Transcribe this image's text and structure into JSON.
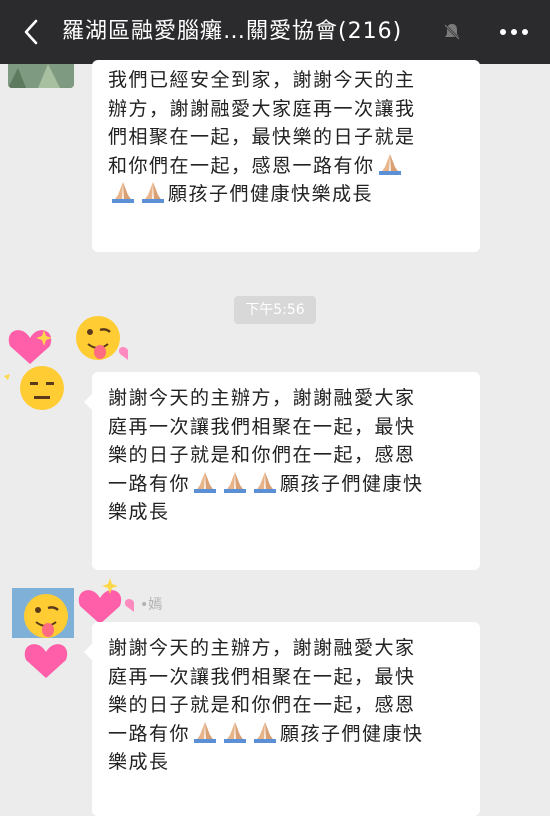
{
  "header": {
    "title": "羅湖區融愛腦癱…關愛協會(216)",
    "back_icon": "chevron-left-icon",
    "mute_icon": "bell-muted-icon",
    "more_icon": "more-dots-icon"
  },
  "messages": [
    {
      "lines": [
        "我們已經安全到家，謝謝今天的主",
        "辦方，謝謝融愛大家庭再一次讓我",
        "們相聚在一起，最快樂的日子就是",
        "和你們在一起，感恩一路有你",
        "願孩子們健康快樂成長"
      ]
    },
    {
      "lines": [
        "謝謝今天的主辦方，謝謝融愛大家",
        "庭再一次讓我們相聚在一起，最快",
        "樂的日子就是和你們在一起，感恩",
        "一路有你",
        "願孩子們健康快",
        "樂成長"
      ]
    },
    {
      "sender": "•嫣",
      "lines": [
        "謝謝今天的主辦方，謝謝融愛大家",
        "庭再一次讓我們相聚在一起，最快",
        "樂的日子就是和你們在一起，感恩",
        "一路有你",
        "願孩子們健康快",
        "樂成長"
      ]
    }
  ],
  "timestamp": "下午5:56",
  "colors": {
    "header_bg": "#2b2b2d",
    "chat_bg": "#ececec",
    "bubble_bg": "#ffffff"
  }
}
